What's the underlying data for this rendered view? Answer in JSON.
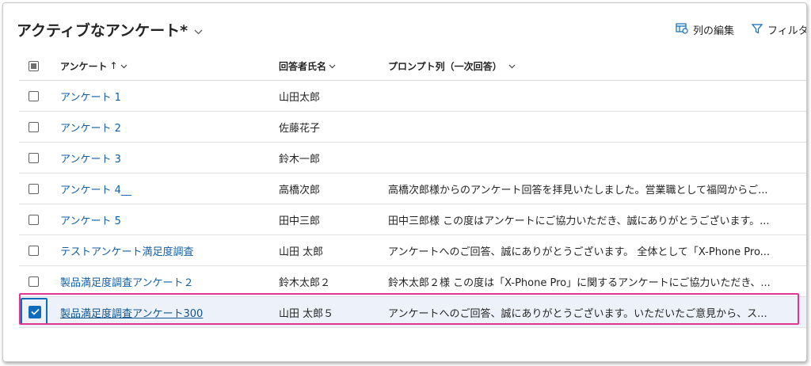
{
  "header": {
    "view_title": "アクティブなアンケート*",
    "edit_columns_label": "列の編集",
    "filter_label": "フィルタ"
  },
  "columns": {
    "survey": "アンケート",
    "survey_sort": "↑",
    "respondent": "回答者氏名",
    "prompt": "プロンプト列（一次回答）"
  },
  "rows": [
    {
      "survey": "アンケート 1",
      "respondent": "山田太郎",
      "prompt": ""
    },
    {
      "survey": "アンケート 2",
      "respondent": "佐藤花子",
      "prompt": ""
    },
    {
      "survey": "アンケート 3",
      "respondent": "鈴木一郎",
      "prompt": ""
    },
    {
      "survey": "アンケート 4__",
      "respondent": "高橋次郎",
      "prompt": "高橋次郎様からのアンケート回答を拝見いたしました。営業職として福岡からご..."
    },
    {
      "survey": "アンケート 5",
      "respondent": "田中三郎",
      "prompt": "田中三郎様 この度はアンケートにご協力いただき、誠にありがとうございます。..."
    },
    {
      "survey": "テストアンケート満足度調査",
      "respondent": "山田 太郎",
      "prompt": "アンケートへのご回答、誠にありがとうございます。 全体として「X-Phone Pro..."
    },
    {
      "survey": "製品満足度調査アンケート２",
      "respondent": "鈴木太郎２",
      "prompt": "鈴木太郎２様 この度は「X-Phone Pro」に関するアンケートにご協力いただき、..."
    },
    {
      "survey": "製品満足度調査アンケート300",
      "respondent": "山田 太郎５",
      "prompt": "アンケートへのご回答、誠にありがとうございます。いただいたご意見から、ス..."
    }
  ],
  "icons": {
    "chevron": "chevron-down-icon",
    "edit_columns": "edit-columns-icon",
    "filter": "filter-icon",
    "check": "checkmark-icon"
  },
  "colors": {
    "accent": "#0f6cbd",
    "link": "#115ea3",
    "highlight": "#e0368f",
    "selected_row": "#edf2fa"
  }
}
